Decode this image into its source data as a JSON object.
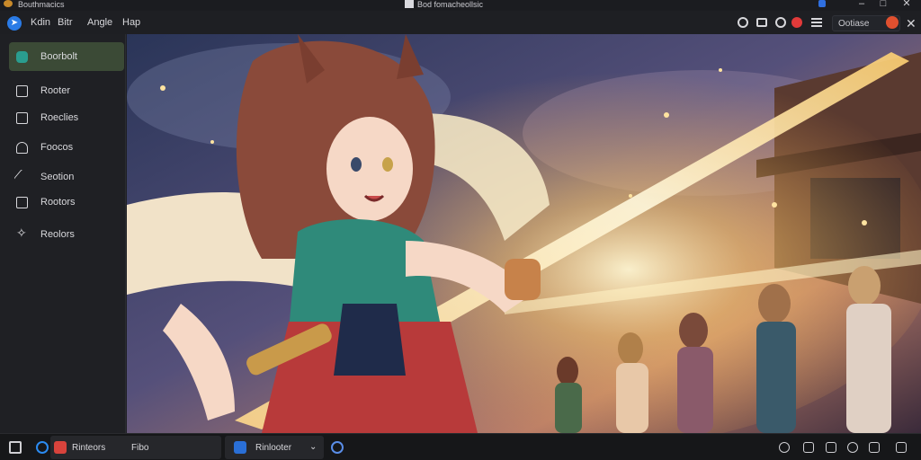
{
  "window": {
    "app_title": "Bouthmacics",
    "document_title": "Bod fomacheollsic"
  },
  "menu": {
    "items": [
      "Kdin",
      "Bitr",
      "Angle",
      "Hap"
    ]
  },
  "toolbar": {
    "search_placeholder": "Ootiase",
    "accent": "#2a7be6",
    "avatar_color": "#e0502f"
  },
  "sidebar": {
    "active_color": "#3b4a36",
    "items": [
      {
        "label": "Boorbolt",
        "icon": "app-icon"
      },
      {
        "label": "Rooter",
        "icon": "square-icon"
      },
      {
        "label": "Roeclies",
        "icon": "image-icon"
      },
      {
        "label": "Foocos",
        "icon": "tag-icon"
      },
      {
        "label": "Seotion",
        "icon": "pen-icon"
      },
      {
        "label": "Rootors",
        "icon": "book-icon"
      },
      {
        "label": "Reolors",
        "icon": "sparkle-icon"
      }
    ]
  },
  "taskbar": {
    "app1_label": "Rinteors",
    "app1_sub": "Fibo",
    "app2_label": "Rinlooter"
  }
}
